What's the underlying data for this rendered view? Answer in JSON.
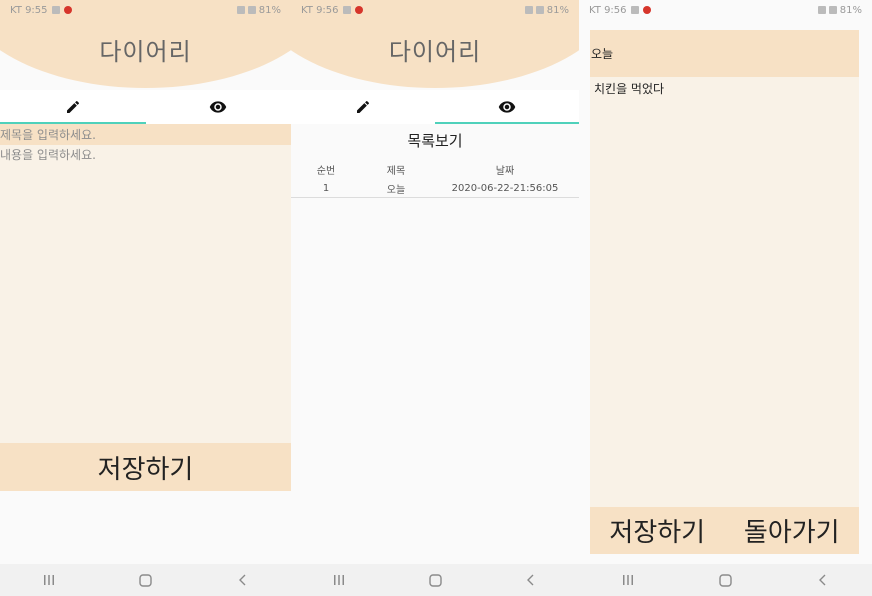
{
  "screens": [
    {
      "status": {
        "carrier_time": "KT 9:55",
        "battery": "81%"
      },
      "app_title": "다이어리",
      "tabs": [
        {
          "icon": "pencil-icon",
          "active": true
        },
        {
          "icon": "eye-icon",
          "active": false
        }
      ],
      "write": {
        "title_placeholder": "제목을 입력하세요.",
        "content_placeholder": "내용을 입력하세요.",
        "save_label": "저장하기"
      }
    },
    {
      "status": {
        "carrier_time": "KT 9:56",
        "battery": "81%"
      },
      "app_title": "다이어리",
      "tabs": [
        {
          "icon": "pencil-icon",
          "active": false
        },
        {
          "icon": "eye-icon",
          "active": true
        }
      ],
      "list": {
        "heading": "목록보기",
        "columns": [
          "순번",
          "제목",
          "날짜"
        ],
        "rows": [
          {
            "num": "1",
            "subject": "오늘",
            "date": "2020-06-22-21:56:05"
          }
        ]
      }
    },
    {
      "status": {
        "carrier_time": "KT 9:56",
        "battery": "81%"
      },
      "detail": {
        "subject": "오늘",
        "content": "치킨을 먹었다",
        "save_label": "저장하기",
        "back_label": "돌아가기"
      }
    }
  ],
  "colors": {
    "accent": "#4fd1bb",
    "header": "#f7e1c5",
    "panel": "#f9f2e7"
  }
}
